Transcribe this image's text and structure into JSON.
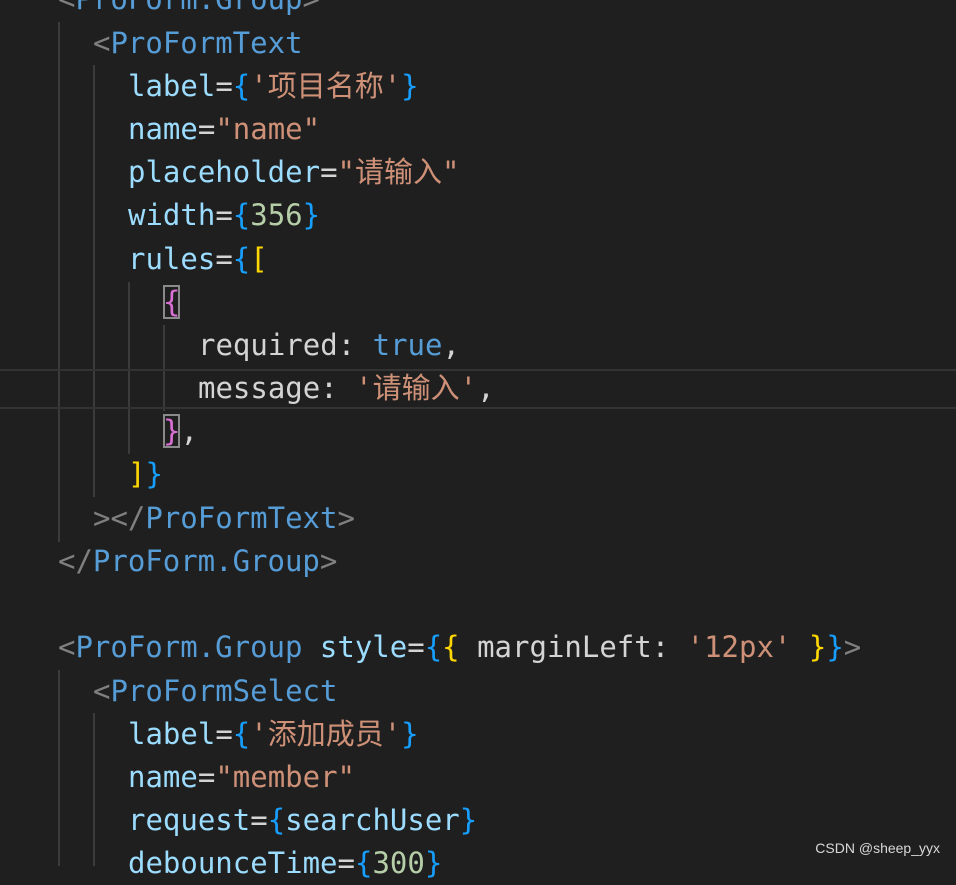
{
  "editor": {
    "lines": [
      [
        {
          "t": "<",
          "c": "c-punc"
        },
        {
          "t": "ProForm.Group",
          "c": "c-tag"
        },
        {
          "t": ">",
          "c": "c-punc"
        }
      ],
      [
        {
          "t": "<",
          "c": "c-punc"
        },
        {
          "t": "ProFormText",
          "c": "c-tag"
        }
      ],
      [
        {
          "t": "label",
          "c": "c-attr"
        },
        {
          "t": "=",
          "c": "c-txt"
        },
        {
          "t": "{",
          "c": "c-b3"
        },
        {
          "t": "'项目名称'",
          "c": "c-str"
        },
        {
          "t": "}",
          "c": "c-b3"
        }
      ],
      [
        {
          "t": "name",
          "c": "c-attr"
        },
        {
          "t": "=",
          "c": "c-txt"
        },
        {
          "t": "\"name\"",
          "c": "c-str"
        }
      ],
      [
        {
          "t": "placeholder",
          "c": "c-attr"
        },
        {
          "t": "=",
          "c": "c-txt"
        },
        {
          "t": "\"请输入\"",
          "c": "c-str"
        }
      ],
      [
        {
          "t": "width",
          "c": "c-attr"
        },
        {
          "t": "=",
          "c": "c-txt"
        },
        {
          "t": "{",
          "c": "c-b3"
        },
        {
          "t": "356",
          "c": "c-num"
        },
        {
          "t": "}",
          "c": "c-b3"
        }
      ],
      [
        {
          "t": "rules",
          "c": "c-attr"
        },
        {
          "t": "=",
          "c": "c-txt"
        },
        {
          "t": "{",
          "c": "c-b3"
        },
        {
          "t": "[",
          "c": "c-b1"
        }
      ],
      [
        {
          "t": "{",
          "c": "c-b2 bm"
        }
      ],
      [
        {
          "t": "required",
          "c": "c-key"
        },
        {
          "t": ": ",
          "c": "c-txt"
        },
        {
          "t": "true",
          "c": "c-kw"
        },
        {
          "t": ",",
          "c": "c-txt"
        }
      ],
      [
        {
          "t": "message",
          "c": "c-key"
        },
        {
          "t": ": ",
          "c": "c-txt"
        },
        {
          "t": "'请输入'",
          "c": "c-str"
        },
        {
          "t": ",",
          "c": "c-txt"
        }
      ],
      [
        {
          "t": "}",
          "c": "c-b2 bm"
        },
        {
          "t": ",",
          "c": "c-txt"
        }
      ],
      [
        {
          "t": "]",
          "c": "c-b1"
        },
        {
          "t": "}",
          "c": "c-b3"
        }
      ],
      [
        {
          "t": "></",
          "c": "c-punc"
        },
        {
          "t": "ProFormText",
          "c": "c-tag"
        },
        {
          "t": ">",
          "c": "c-punc"
        }
      ],
      [
        {
          "t": "</",
          "c": "c-punc"
        },
        {
          "t": "ProForm.Group",
          "c": "c-tag"
        },
        {
          "t": ">",
          "c": "c-punc"
        }
      ],
      [],
      [
        {
          "t": "<",
          "c": "c-punc"
        },
        {
          "t": "ProForm.Group",
          "c": "c-tag"
        },
        {
          "t": " ",
          "c": "c-txt"
        },
        {
          "t": "style",
          "c": "c-attr"
        },
        {
          "t": "=",
          "c": "c-txt"
        },
        {
          "t": "{",
          "c": "c-b3"
        },
        {
          "t": "{",
          "c": "c-b1"
        },
        {
          "t": " marginLeft",
          "c": "c-key"
        },
        {
          "t": ": ",
          "c": "c-txt"
        },
        {
          "t": "'12px'",
          "c": "c-str"
        },
        {
          "t": " ",
          "c": "c-txt"
        },
        {
          "t": "}",
          "c": "c-b1"
        },
        {
          "t": "}",
          "c": "c-b3"
        },
        {
          "t": ">",
          "c": "c-punc"
        }
      ],
      [
        {
          "t": "<",
          "c": "c-punc"
        },
        {
          "t": "ProFormSelect",
          "c": "c-tag"
        }
      ],
      [
        {
          "t": "label",
          "c": "c-attr"
        },
        {
          "t": "=",
          "c": "c-txt"
        },
        {
          "t": "{",
          "c": "c-b3"
        },
        {
          "t": "'添加成员'",
          "c": "c-str"
        },
        {
          "t": "}",
          "c": "c-b3"
        }
      ],
      [
        {
          "t": "name",
          "c": "c-attr"
        },
        {
          "t": "=",
          "c": "c-txt"
        },
        {
          "t": "\"member\"",
          "c": "c-str"
        }
      ],
      [
        {
          "t": "request",
          "c": "c-attr"
        },
        {
          "t": "=",
          "c": "c-txt"
        },
        {
          "t": "{",
          "c": "c-b3"
        },
        {
          "t": "searchUser",
          "c": "c-var"
        },
        {
          "t": "}",
          "c": "c-b3"
        }
      ],
      [
        {
          "t": "debounceTime",
          "c": "c-attr"
        },
        {
          "t": "=",
          "c": "c-txt"
        },
        {
          "t": "{",
          "c": "c-b3"
        },
        {
          "t": "300",
          "c": "c-num"
        },
        {
          "t": "}",
          "c": "c-b3"
        }
      ]
    ]
  },
  "watermark": "CSDN @sheep_yyx"
}
